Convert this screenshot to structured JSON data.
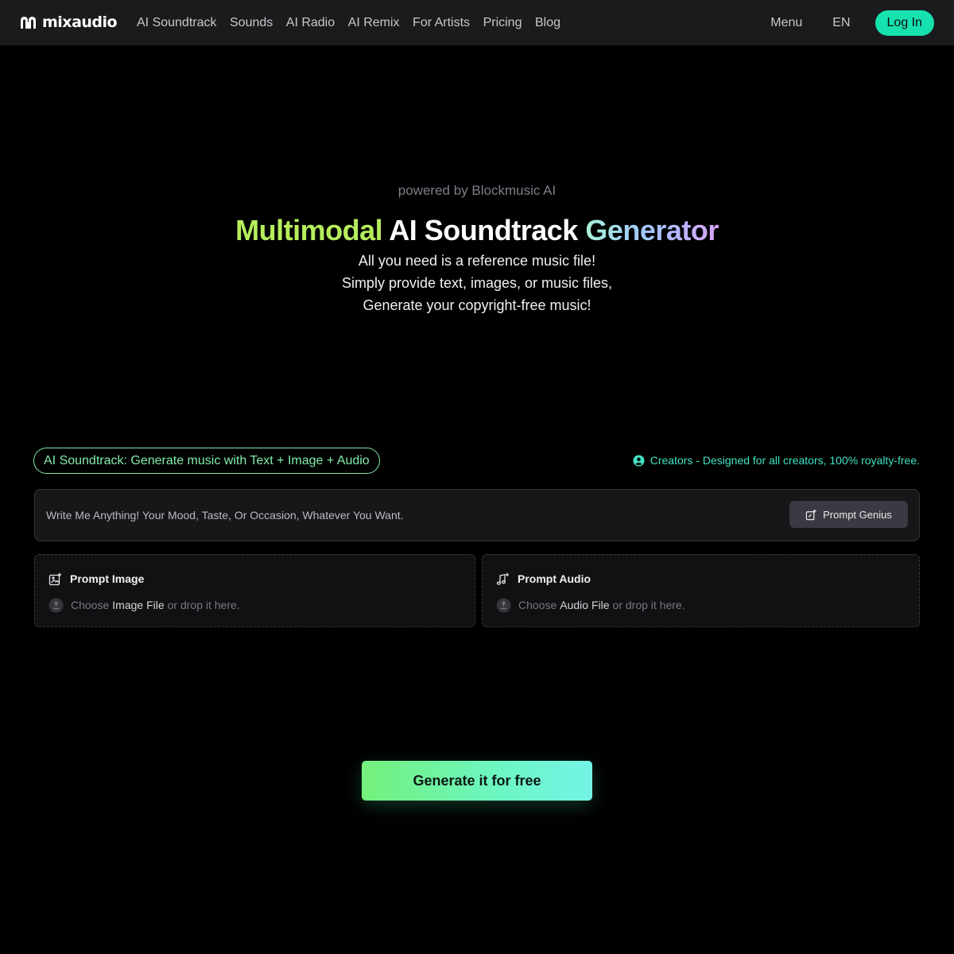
{
  "brand": {
    "name": "mixaudio"
  },
  "nav": {
    "items": [
      {
        "label": "AI Soundtrack"
      },
      {
        "label": "Sounds"
      },
      {
        "label": "AI Radio"
      },
      {
        "label": "AI Remix"
      },
      {
        "label": "For Artists"
      },
      {
        "label": "Pricing"
      },
      {
        "label": "Blog"
      }
    ],
    "menu_label": "Menu",
    "lang_label": "EN",
    "login_label": "Log In"
  },
  "hero": {
    "powered_by": "powered by Blockmusic AI",
    "title_part1": "Multimodal",
    "title_part2": "AI Soundtrack",
    "title_part3": "Generator",
    "subtitle_line1": "All you need is a reference music file!",
    "subtitle_line2": "Simply provide text, images, or music files,",
    "subtitle_line3": "Generate your copyright-free music!"
  },
  "feature": {
    "tag_label": "AI Soundtrack: Generate music with Text + Image + Audio",
    "creators_text": "Creators - Designed for all creators, 100% royalty-free."
  },
  "prompt": {
    "placeholder": "Write Me Anything! Your Mood, Taste, Or Occasion, Whatever You Want.",
    "value": "",
    "genius_label": "Prompt Genius"
  },
  "upload": {
    "image": {
      "title": "Prompt Image",
      "choose_prefix": "Choose",
      "file_label": "Image File",
      "drop_suffix": "or drop it here."
    },
    "audio": {
      "title": "Prompt Audio",
      "choose_prefix": "Choose",
      "file_label": "Audio File",
      "drop_suffix": "or drop it here."
    }
  },
  "generate": {
    "label": "Generate it for free"
  },
  "colors": {
    "background": "#000000",
    "header": "#1b1b1d",
    "accent": "#16e2b0",
    "tag_green": "#82eba8",
    "creators_teal": "#41e2c4",
    "title_green": "#b6ee5c"
  },
  "icons": {
    "logo": "mixaudio-logo-icon",
    "creators": "user-circle-icon",
    "genius": "magic-edit-icon",
    "image": "image-add-icon",
    "audio": "music-note-add-icon",
    "upload": "upload-icon"
  }
}
